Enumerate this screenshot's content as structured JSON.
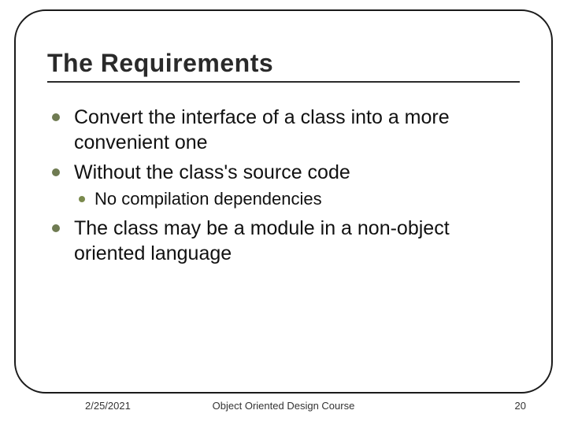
{
  "title": "The Requirements",
  "bullets": {
    "item1": "Convert the interface of a class into a more convenient one",
    "item2": "Without the class's source code",
    "item2_sub1": "No compilation dependencies",
    "item3": "The class may be a module in a non-object oriented language"
  },
  "footer": {
    "date": "2/25/2021",
    "course": "Object Oriented Design Course",
    "page": "20"
  }
}
